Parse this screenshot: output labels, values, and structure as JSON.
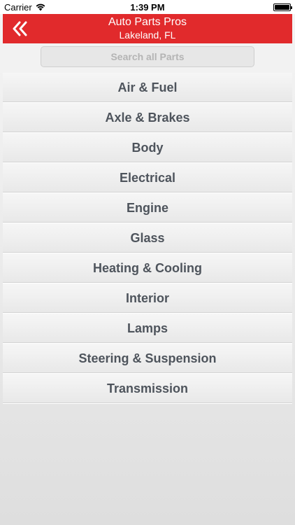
{
  "status_bar": {
    "carrier": "Carrier",
    "time": "1:39 PM"
  },
  "header": {
    "title": "Auto Parts Pros",
    "subtitle": "Lakeland, FL",
    "back_icon": "double-chevron-left-icon"
  },
  "search": {
    "placeholder": "Search all Parts",
    "value": ""
  },
  "categories": [
    {
      "label": "Air & Fuel"
    },
    {
      "label": "Axle & Brakes"
    },
    {
      "label": "Body"
    },
    {
      "label": "Electrical"
    },
    {
      "label": "Engine"
    },
    {
      "label": "Glass"
    },
    {
      "label": "Heating & Cooling"
    },
    {
      "label": "Interior"
    },
    {
      "label": "Lamps"
    },
    {
      "label": "Steering & Suspension"
    },
    {
      "label": "Transmission"
    }
  ],
  "colors": {
    "header_bg": "#e12a2c",
    "category_text": "#4e545c"
  }
}
